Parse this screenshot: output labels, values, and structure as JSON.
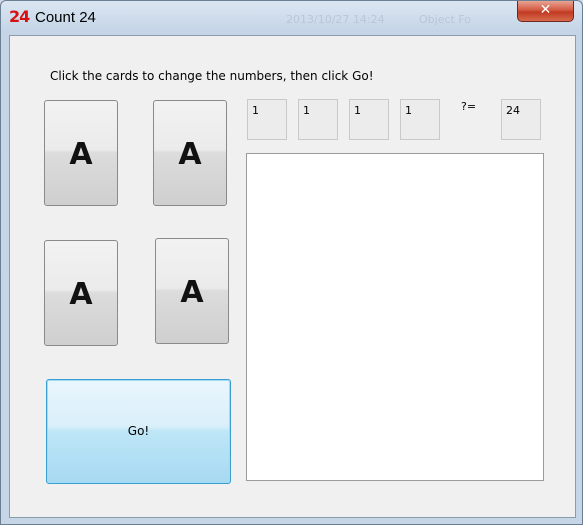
{
  "window": {
    "logo_text": "24",
    "title": "Count 24",
    "close_symbol": "✕",
    "background_ghost": [
      "2013/10/27 14:24",
      "Object Fo"
    ]
  },
  "instruction": "Click the cards to change the numbers, then click Go!",
  "cards": [
    {
      "label": "A"
    },
    {
      "label": "A"
    },
    {
      "label": "A"
    },
    {
      "label": "A"
    }
  ],
  "numbers": [
    "1",
    "1",
    "1",
    "1"
  ],
  "equals_label": "?=",
  "target": "24",
  "result_text": "",
  "go_label": "Go!",
  "colors": {
    "logo": "#d81010",
    "go_button_border": "#3c9fd0"
  }
}
